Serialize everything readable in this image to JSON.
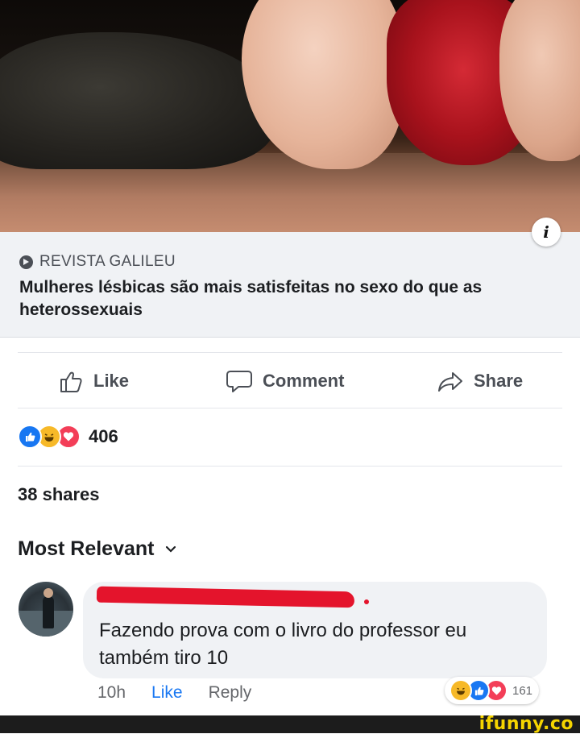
{
  "post": {
    "source": "REVISTA GALILEU",
    "headline": "Mulheres lésbicas são mais satisfeitas no sexo do que as heterossexuais",
    "info_icon": "i"
  },
  "actions": {
    "like": "Like",
    "comment": "Comment",
    "share": "Share"
  },
  "stats": {
    "reaction_count": "406",
    "reaction_icons": [
      "like-reaction-icon",
      "haha-reaction-icon",
      "love-reaction-icon"
    ],
    "shares": "38 shares"
  },
  "comments_section": {
    "sort_label": "Most Relevant",
    "sort_icon": "chevron-down-icon"
  },
  "comment": {
    "author_redacted": true,
    "text": "Fazendo prova com o livro do professor eu também tiro 10",
    "time": "10h",
    "like_label": "Like",
    "reply_label": "Reply",
    "reaction_count": "161",
    "reaction_icons": [
      "haha-reaction-icon",
      "like-reaction-icon",
      "love-reaction-icon"
    ]
  },
  "watermark": "ifunny.co",
  "colors": {
    "link_blue": "#1877f2",
    "like_blue": "#1877f2",
    "haha_yellow": "#f7b928",
    "love_red": "#f33e58",
    "card_bg": "#f0f2f5",
    "redaction_red": "#e4142c",
    "watermark_yellow": "#f5d400"
  }
}
